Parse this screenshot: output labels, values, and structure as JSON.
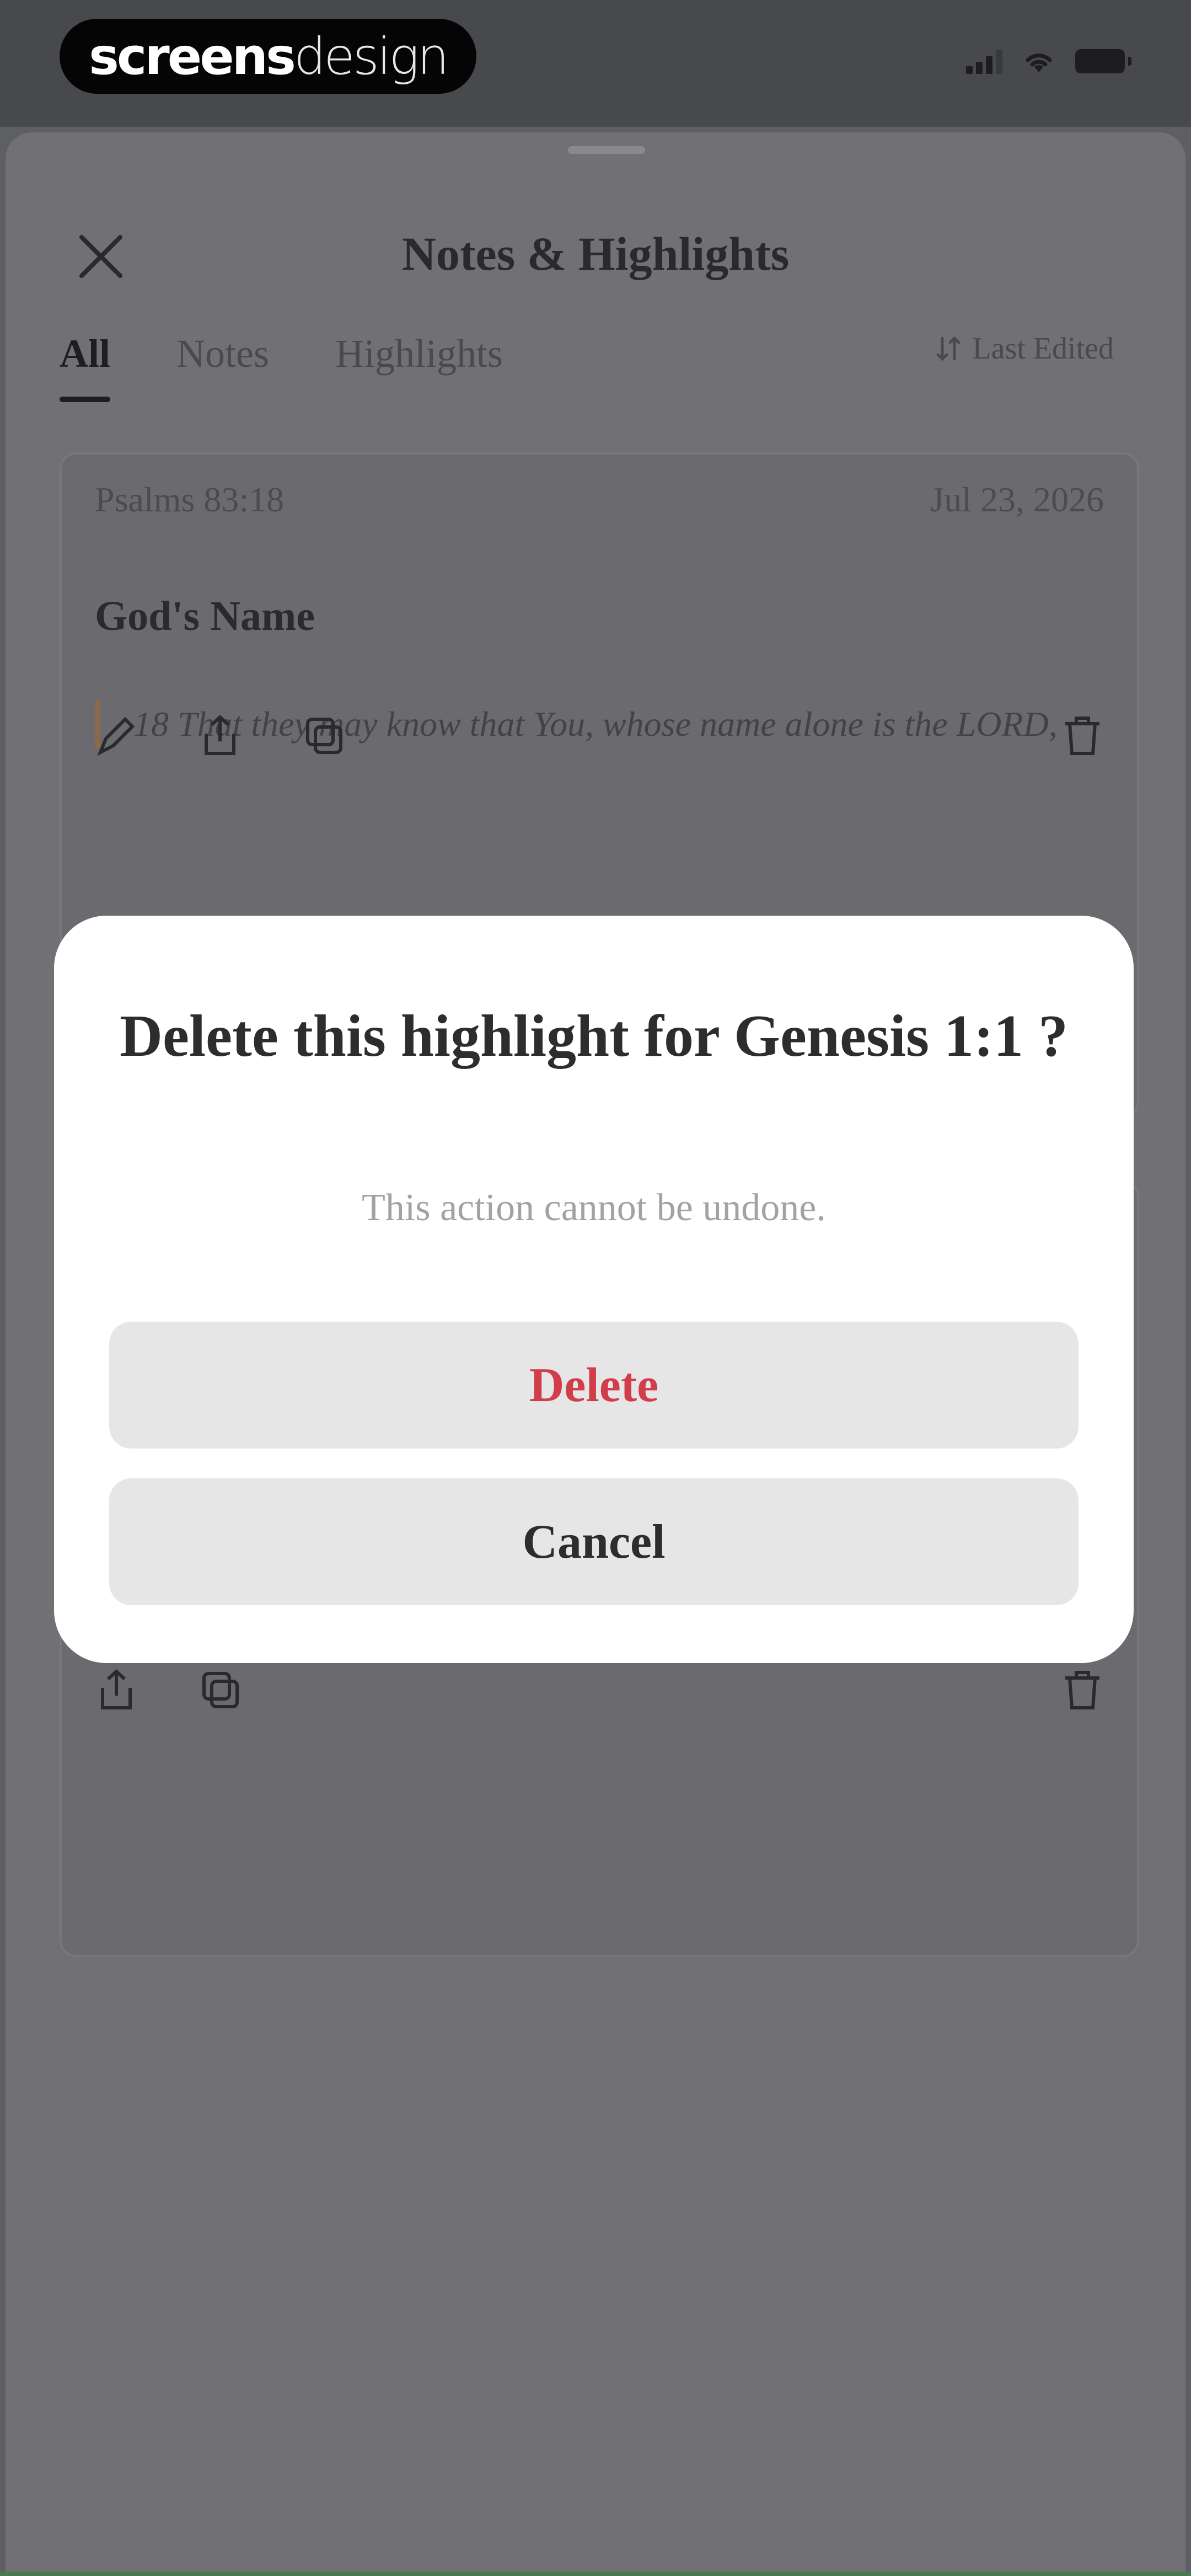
{
  "status_bar": {
    "logo_part1": "screens",
    "logo_part2": "design"
  },
  "sheet": {
    "title": "Notes & Highlights",
    "tabs": [
      {
        "label": "All",
        "active": true
      },
      {
        "label": "Notes",
        "active": false
      },
      {
        "label": "Highlights",
        "active": false
      }
    ],
    "sort_label": "Last Edited",
    "cards": [
      {
        "reference": "Psalms 83:18",
        "date": "Jul 23, 2026",
        "title": "God's Name",
        "verse": "18 That they may know that You, whose name alone is the LORD,"
      }
    ]
  },
  "modal": {
    "title": "Delete this highlight for Genesis 1:1 ?",
    "subtitle": "This action cannot be undone.",
    "delete_label": "Delete",
    "cancel_label": "Cancel"
  },
  "colors": {
    "delete_text": "#d23d4a",
    "overlay": "#717175",
    "verse_bar": "#8a6a4a"
  }
}
